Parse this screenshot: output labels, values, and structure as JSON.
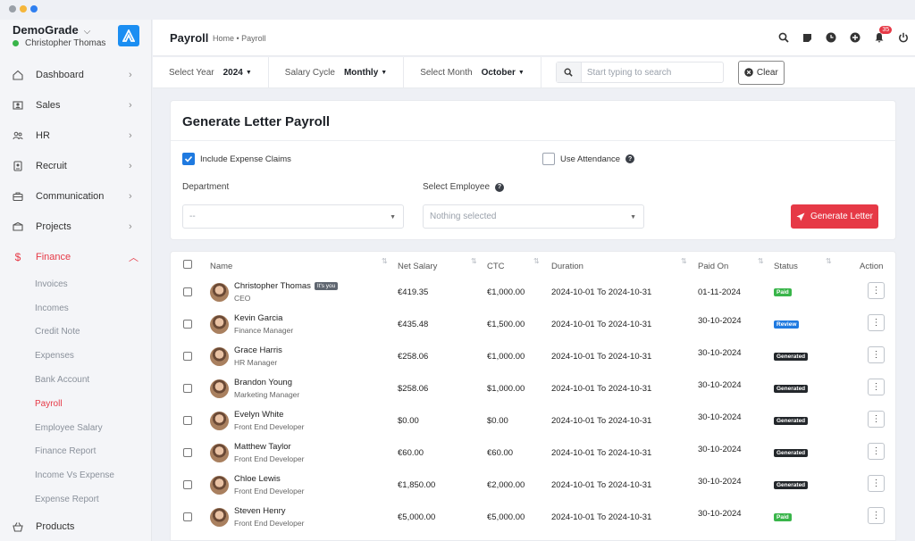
{
  "colors": {
    "accent": "#e63946",
    "brand_logo": "#1b8ef2",
    "checkbox_checked": "#1f7ae0",
    "status_paid": "#39b54a",
    "status_review": "#1f7ae0",
    "status_generated": "#23272b"
  },
  "sidebar": {
    "company": "DemoGrade",
    "user": "Christopher Thomas",
    "items": [
      {
        "label": "Dashboard",
        "icon": "home-icon"
      },
      {
        "label": "Sales",
        "icon": "person-card-icon"
      },
      {
        "label": "HR",
        "icon": "users-icon"
      },
      {
        "label": "Recruit",
        "icon": "id-badge-icon"
      },
      {
        "label": "Communication",
        "icon": "briefcase-icon"
      },
      {
        "label": "Projects",
        "icon": "box-icon"
      },
      {
        "label": "Finance",
        "icon": "dollar-icon",
        "active": true
      }
    ],
    "finance_sub": [
      "Invoices",
      "Incomes",
      "Credit Note",
      "Expenses",
      "Bank Account",
      "Payroll",
      "Employee Salary",
      "Finance Report",
      "Income Vs Expense",
      "Expense Report"
    ],
    "active_sub": "Payroll",
    "bottom_item": {
      "label": "Products",
      "icon": "basket-icon"
    }
  },
  "header": {
    "title": "Payroll",
    "breadcrumb": "Home • Payroll",
    "notification_count": "35",
    "icons": [
      "search-icon",
      "sticky-note-icon",
      "clock-icon",
      "add-circle-icon",
      "bell-icon",
      "power-icon"
    ]
  },
  "filters": {
    "year_label": "Select Year",
    "year_value": "2024",
    "cycle_label": "Salary Cycle",
    "cycle_value": "Monthly",
    "month_label": "Select Month",
    "month_value": "October",
    "search_placeholder": "Start typing to search",
    "clear_label": "Clear"
  },
  "generate": {
    "title": "Generate Letter Payroll",
    "include_expense": "Include Expense Claims",
    "include_expense_checked": true,
    "use_attendance": "Use Attendance",
    "use_attendance_checked": false,
    "department_label": "Department",
    "department_value": "--",
    "employee_label": "Select Employee",
    "employee_value": "Nothing selected",
    "button": "Generate Letter"
  },
  "table": {
    "columns": [
      "Name",
      "Net Salary",
      "CTC",
      "Duration",
      "Paid On",
      "Status",
      "Action"
    ],
    "you_tag": "It's you",
    "rows": [
      {
        "name": "Christopher Thomas",
        "you": true,
        "role": "CEO",
        "net": "€419.35",
        "ctc": "€1,000.00",
        "duration": "2024-10-01 To 2024-10-31",
        "paid_on": "01-11-2024",
        "status": "Paid"
      },
      {
        "name": "Kevin Garcia",
        "role": "Finance Manager",
        "net": "€435.48",
        "ctc": "€1,500.00",
        "duration": "2024-10-01 To 2024-10-31",
        "paid_on": "30-10-2024",
        "status": "Review"
      },
      {
        "name": "Grace Harris",
        "role": "HR Manager",
        "net": "€258.06",
        "ctc": "€1,000.00",
        "duration": "2024-10-01 To 2024-10-31",
        "paid_on": "30-10-2024",
        "status": "Generated"
      },
      {
        "name": "Brandon Young",
        "role": "Marketing Manager",
        "net": "$258.06",
        "ctc": "$1,000.00",
        "duration": "2024-10-01 To 2024-10-31",
        "paid_on": "30-10-2024",
        "status": "Generated"
      },
      {
        "name": "Evelyn White",
        "role": "Front End Developer",
        "net": "$0.00",
        "ctc": "$0.00",
        "duration": "2024-10-01 To 2024-10-31",
        "paid_on": "30-10-2024",
        "status": "Generated"
      },
      {
        "name": "Matthew Taylor",
        "role": "Front End Developer",
        "net": "€60.00",
        "ctc": "€60.00",
        "duration": "2024-10-01 To 2024-10-31",
        "paid_on": "30-10-2024",
        "status": "Generated"
      },
      {
        "name": "Chloe Lewis",
        "role": "Front End Developer",
        "net": "€1,850.00",
        "ctc": "€2,000.00",
        "duration": "2024-10-01 To 2024-10-31",
        "paid_on": "30-10-2024",
        "status": "Generated"
      },
      {
        "name": "Steven Henry",
        "role": "Front End Developer",
        "net": "€5,000.00",
        "ctc": "€5,000.00",
        "duration": "2024-10-01 To 2024-10-31",
        "paid_on": "30-10-2024",
        "status": "Paid"
      }
    ]
  }
}
